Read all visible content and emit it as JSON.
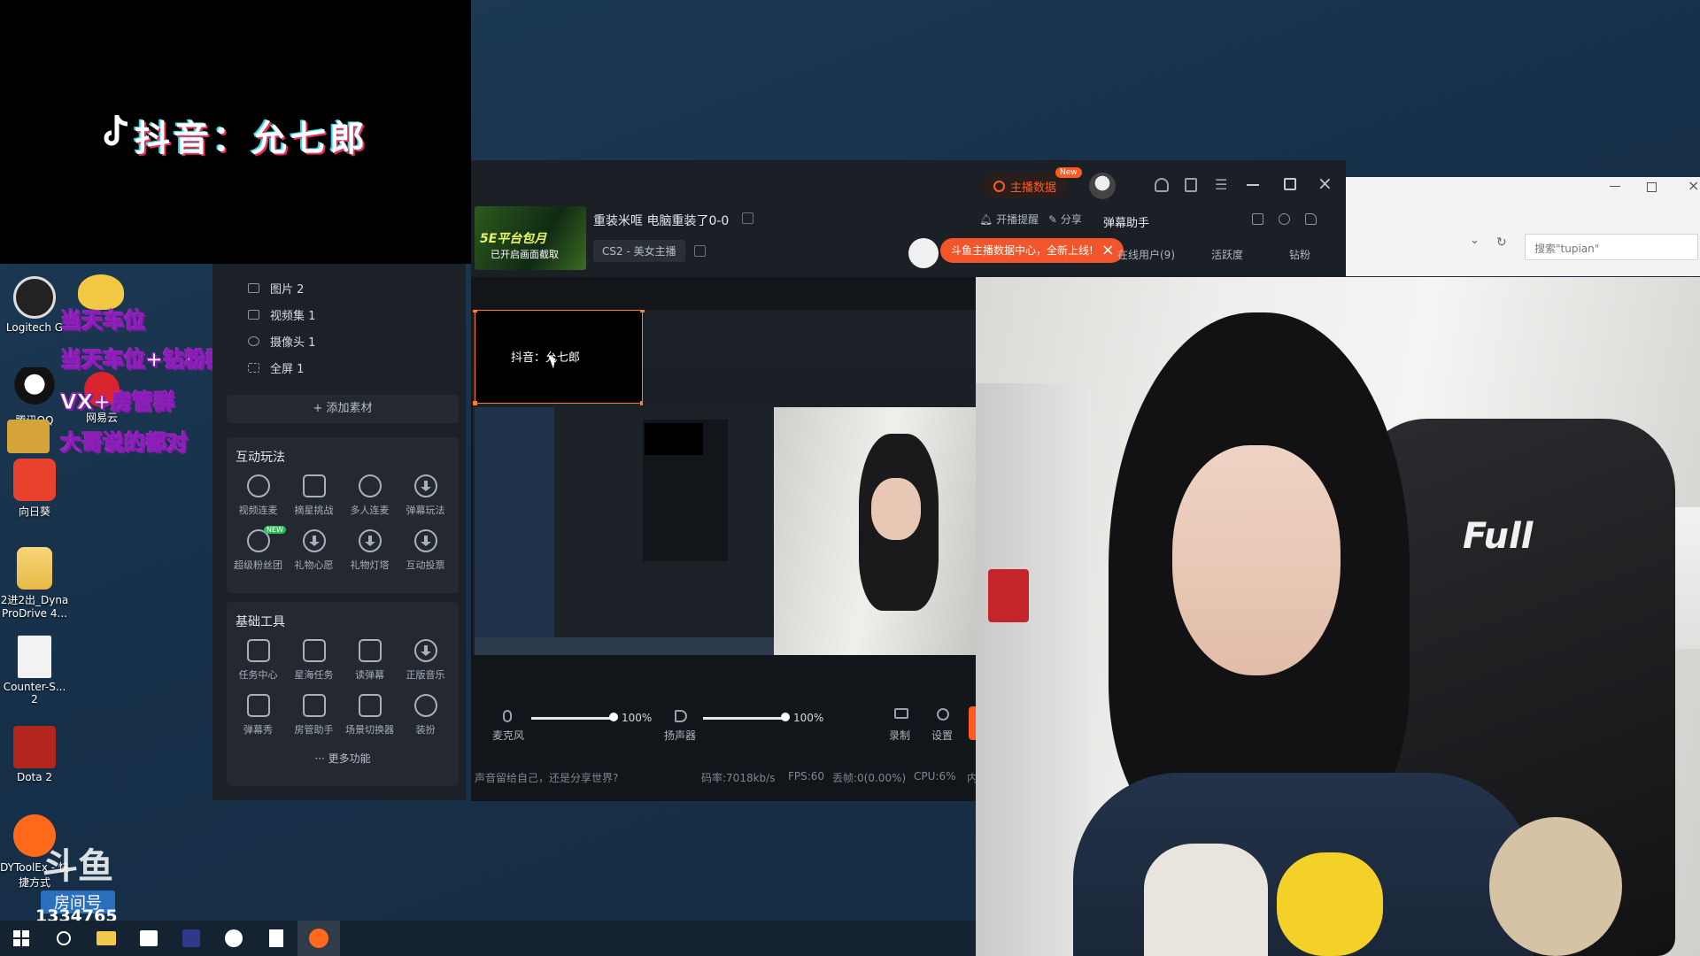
{
  "overlay": {
    "title": "抖音：允七郎"
  },
  "desktop": {
    "icons": [
      {
        "label": "Logitech G",
        "icon": "logitech-icon"
      },
      {
        "label": "腾讯QQ",
        "icon": "qq-penguin-icon"
      },
      {
        "label": "向日葵",
        "icon": "sunflower-icon"
      },
      {
        "label": "2进2出_Dyna ProDrive 4...",
        "icon": "folder-icon"
      },
      {
        "label": "Counter-S... 2",
        "icon": "file-icon"
      },
      {
        "label": "Dota 2",
        "icon": "dota-icon"
      },
      {
        "label": "DYToolEx - 快捷方式",
        "icon": "douyu-tool-icon"
      },
      {
        "label": "网易云",
        "icon": "netease-music-icon"
      }
    ],
    "promo_lines": [
      "当天车位",
      "当天车位+钻粉群",
      "VX+房管群",
      "大哥说的都对"
    ],
    "room": {
      "brand": "斗鱼",
      "label": "房间号",
      "number": "1334765"
    }
  },
  "sources": [
    {
      "label": "图片 2"
    },
    {
      "label": "视频集 1"
    },
    {
      "label": "摄像头 1"
    },
    {
      "label": "全屏 1"
    }
  ],
  "add_source_label": "+ 添加素材",
  "interactive": {
    "heading": "互动玩法",
    "tools": [
      {
        "label": "视频连麦",
        "icon": "video-link-icon"
      },
      {
        "label": "摘星挑战",
        "icon": "star-shield-icon"
      },
      {
        "label": "多人连麦",
        "icon": "multi-link-icon"
      },
      {
        "label": "弹幕玩法",
        "icon": "download-icon"
      },
      {
        "label": "超级粉丝团",
        "icon": "fan-club-icon",
        "badge": "NEW"
      },
      {
        "label": "礼物心愿",
        "icon": "download-icon"
      },
      {
        "label": "礼物灯塔",
        "icon": "download-icon"
      },
      {
        "label": "互动投票",
        "icon": "download-icon"
      }
    ]
  },
  "basic": {
    "heading": "基础工具",
    "tools": [
      {
        "label": "任务中心",
        "icon": "task-center-icon"
      },
      {
        "label": "星海任务",
        "icon": "ad-icon"
      },
      {
        "label": "读弹幕",
        "icon": "read-danmaku-icon"
      },
      {
        "label": "正版音乐",
        "icon": "download-icon"
      },
      {
        "label": "弹幕秀",
        "icon": "tv-icon"
      },
      {
        "label": "房管助手",
        "icon": "house-icon"
      },
      {
        "label": "场景切换器",
        "icon": "scene-switch-icon"
      },
      {
        "label": "装扮",
        "icon": "face-icon"
      }
    ]
  },
  "more_label": "··· 更多功能",
  "stream": {
    "title": "重装米哐 电脑重装了0-0",
    "category": "CS2 - 美女主播",
    "thumb_caption": "已开启画面截取",
    "thumb_banner": "5E平台包月"
  },
  "header": {
    "host_data": "主播数据",
    "new_badge": "New",
    "notify": "开播提醒",
    "share": "分享",
    "danmaku_helper": "弹幕助手",
    "toast": "斗鱼主播数据中心，全新上线!",
    "tabs": [
      "在线用户(9)",
      "活跃度",
      "钻粉"
    ]
  },
  "preview_title": "抖音：允七郎",
  "audio": {
    "mic": {
      "label": "麦克风",
      "value": "100%",
      "level": 1.0
    },
    "speaker": {
      "label": "扬声器",
      "value": "100%",
      "level": 1.0
    },
    "record": "录制",
    "settings": "设置"
  },
  "status": {
    "tip": "声音留给自己，还是分享世界?",
    "bitrate": "码率:7018kb/s",
    "fps": "FPS:60",
    "dropped": "丢帧:0(0.00%)",
    "cpu": "CPU:6%",
    "extra": "内"
  },
  "explorer": {
    "search_placeholder": "搜索\"tupian\""
  },
  "webcam_text": "Full",
  "colors": {
    "accent": "#ff5a1f",
    "panel": "#1c2027",
    "promo_stroke": "#8b1fb8"
  }
}
